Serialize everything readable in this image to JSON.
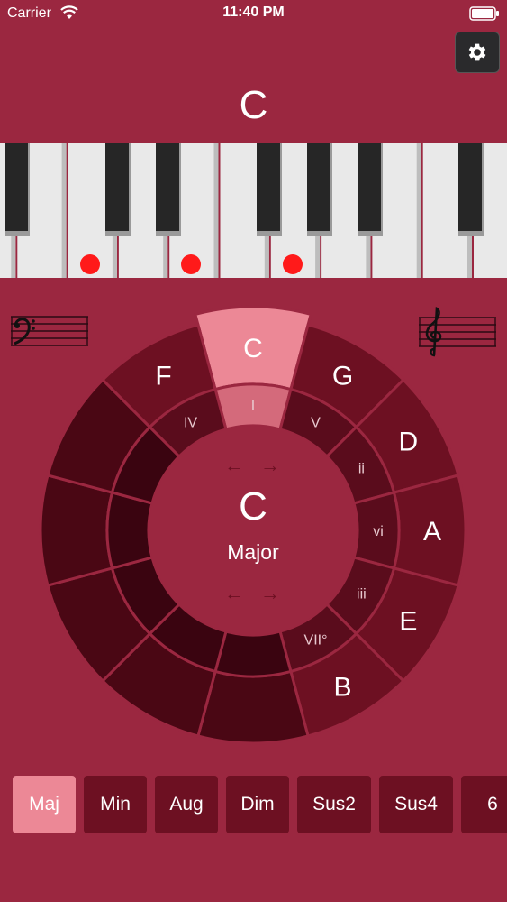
{
  "status_bar": {
    "carrier": "Carrier",
    "time": "11:40 PM"
  },
  "header": {
    "chord_name": "C"
  },
  "piano": {
    "highlighted_note_dots": 3
  },
  "wheel": {
    "outer_keys": [
      "C",
      "G",
      "D",
      "A",
      "E",
      "B",
      "",
      "",
      "",
      "",
      "",
      "F"
    ],
    "inner_degrees": [
      "I",
      "V",
      "ii",
      "vi",
      "iii",
      "VII°",
      "",
      "",
      "",
      "",
      "",
      "IV"
    ],
    "selected_key": "C",
    "center": {
      "root": "C",
      "quality": "Major",
      "top_arrows": "← →",
      "bottom_arrows": "← →"
    }
  },
  "chord_types": {
    "items": [
      "Maj",
      "Min",
      "Aug",
      "Dim",
      "Sus2",
      "Sus4",
      "6"
    ],
    "selected": "Maj"
  },
  "colors": {
    "background": "#9b2740",
    "selected_outer": "#ec8896",
    "selected_inner": "#d46a7b",
    "active_outer": "#6d1022",
    "active_inner": "#5a0c1c",
    "inactive_outer": "#4a0714",
    "inactive_inner": "#3a0410",
    "center": "#9b2740",
    "note_dot": "#ff1a1a"
  }
}
